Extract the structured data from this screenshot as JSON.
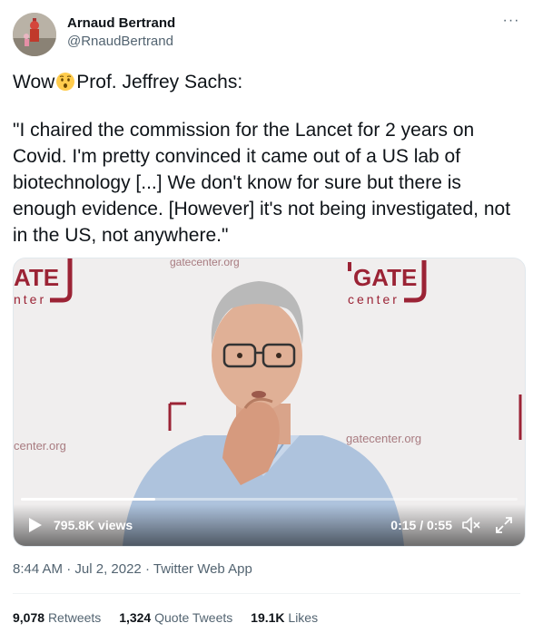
{
  "author": {
    "name": "Arnaud Bertrand",
    "handle": "@RnaudBertrand"
  },
  "more_label": "···",
  "tweet": {
    "line1_pre": "Wow",
    "line1_emoji": "hushed-face-emoji",
    "line1_post": "Prof. Jeffrey Sachs:",
    "quote": "\"I chaired the commission for the Lancet for 2 years on Covid. I'm pretty convinced it came out of a US lab of biotechnology [...] We don't know for sure but there is enough evidence. [However] it's not being investigated, not in the US, not anywhere.\""
  },
  "video": {
    "backdrop": {
      "top_url": "gatecenter.org",
      "logo_right": "GATE",
      "logo_right_sub": "center",
      "logo_left": "ATE",
      "logo_left_sub": "nter",
      "url_left": "center.org",
      "url_right": "gatecenter.org"
    },
    "views": "795.8K views",
    "time": "0:15 / 0:55",
    "progress": 0.27
  },
  "meta": {
    "time": "8:44 AM",
    "separator": "·",
    "date": "Jul 2, 2022",
    "source": "Twitter Web App"
  },
  "stats": {
    "retweets_count": "9,078",
    "retweets_label": "Retweets",
    "quotes_count": "1,324",
    "quotes_label": "Quote Tweets",
    "likes_count": "19.1K",
    "likes_label": "Likes"
  },
  "colors": {
    "text": "#0f1419",
    "secondary": "#536471",
    "gate_brand": "#9b2335"
  }
}
